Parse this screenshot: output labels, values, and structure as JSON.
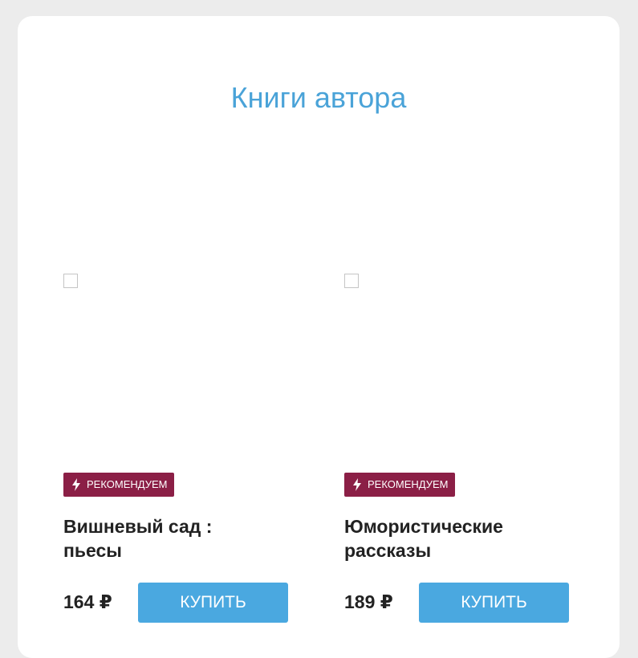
{
  "section": {
    "title": "Книги автора"
  },
  "colors": {
    "title": "#4aa3d8",
    "badge_bg": "#8b1f46",
    "buy_button_bg": "#4aa8e0",
    "text": "#222222",
    "page_bg": "#ececec"
  },
  "books": [
    {
      "badge": "РЕКОМЕНДУЕМ",
      "badge_icon": "lightning-icon",
      "title": "Вишневый сад : пьесы",
      "price": "164 ₽",
      "buy_label": "КУПИТЬ",
      "cover_icon": "broken-image-icon"
    },
    {
      "badge": "РЕКОМЕНДУЕМ",
      "badge_icon": "lightning-icon",
      "title": "Юмористические рассказы",
      "price": "189 ₽",
      "buy_label": "КУПИТЬ",
      "cover_icon": "broken-image-icon"
    }
  ]
}
